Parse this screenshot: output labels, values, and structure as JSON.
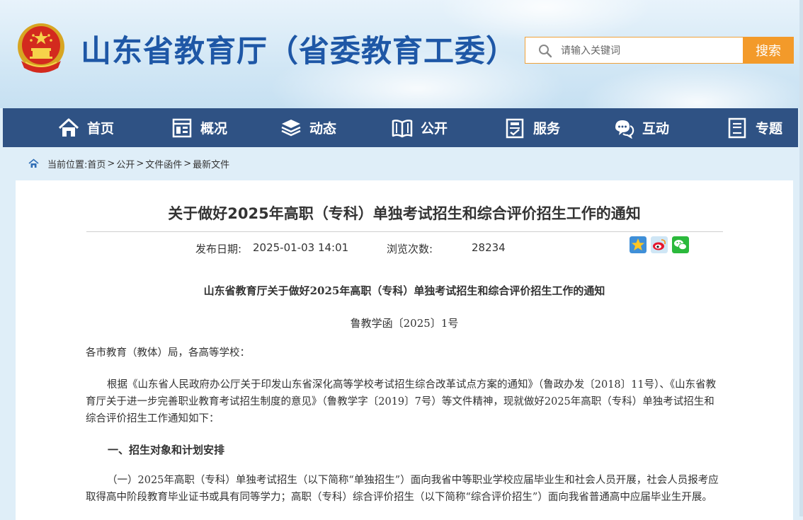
{
  "header": {
    "site_title": "山东省教育厅（省委教育工委）",
    "search": {
      "placeholder": "请输入关键词",
      "button_label": "搜索"
    }
  },
  "nav": {
    "items": [
      {
        "label": "首页",
        "icon": "home-icon"
      },
      {
        "label": "概况",
        "icon": "overview-icon"
      },
      {
        "label": "动态",
        "icon": "news-stack-icon"
      },
      {
        "label": "公开",
        "icon": "open-book-icon"
      },
      {
        "label": "服务",
        "icon": "service-doc-icon"
      },
      {
        "label": "互动",
        "icon": "chat-bubbles-icon"
      },
      {
        "label": "专题",
        "icon": "topic-doc-icon"
      }
    ]
  },
  "breadcrumb": {
    "prefix": "当前位置:",
    "items": [
      "首页",
      "公开",
      "文件函件",
      "最新文件"
    ],
    "separator": ">"
  },
  "article": {
    "title": "关于做好2025年高职（专科）单独考试招生和综合评价招生工作的通知",
    "publish_label": "发布日期:",
    "publish_value": "2025-01-03 14:01",
    "views_label": "浏览次数:",
    "views_value": "28234",
    "share_icons": [
      "favorite-star-icon",
      "weibo-icon",
      "wechat-icon"
    ],
    "doc_heading": "山东省教育厅关于做好2025年高职（专科）单独考试招生和综合评价招生工作的通知",
    "doc_number": "鲁教学函〔2025〕1号",
    "salutation": "各市教育（教体）局，各高等学校：",
    "para1": "根据《山东省人民政府办公厅关于印发山东省深化高等学校考试招生综合改革试点方案的通知》（鲁政办发〔2018〕11号）、《山东省教育厅关于进一步完善职业教育考试招生制度的意见》（鲁教学字〔2019〕7号）等文件精神，现就做好2025年高职（专科）单独考试招生和综合评价招生工作通知如下：",
    "section1": "一、招生对象和计划安排",
    "para2": "（一）2025年高职（专科）单独考试招生（以下简称“单独招生”）面向我省中等职业学校应届毕业生和社会人员开展，社会人员报考应取得高中阶段教育毕业证书或具有同等学力；高职（专科）综合评价招生（以下简称“综合评价招生”）面向我省普通高中应届毕业生开展。"
  },
  "colors": {
    "nav_bg": "#2f5284",
    "title_blue": "#1e57a6",
    "search_orange": "#f39a2a"
  }
}
